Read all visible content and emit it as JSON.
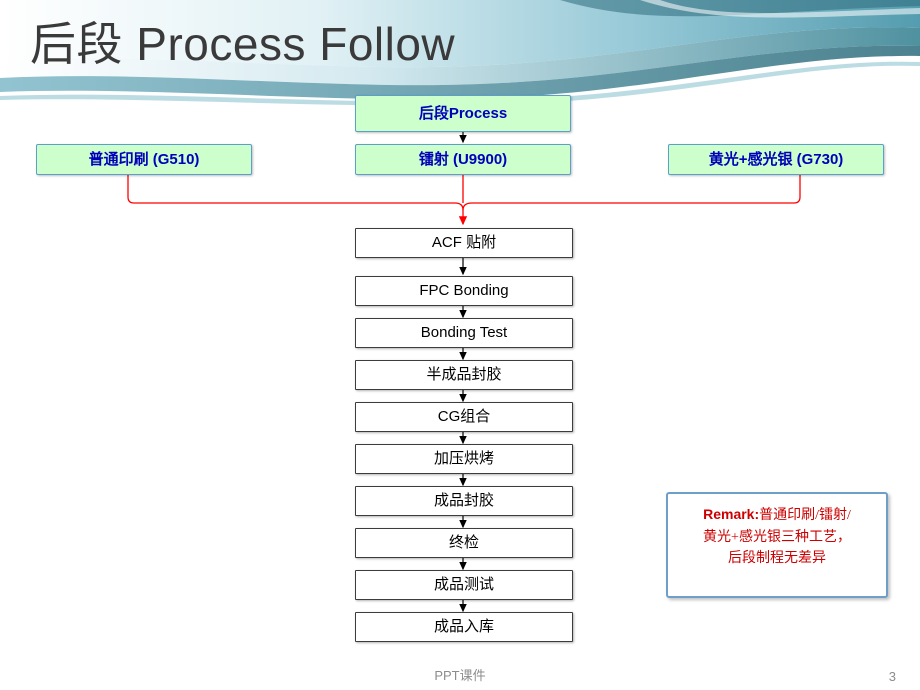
{
  "slide": {
    "title": "后段 Process  Follow",
    "footer": "PPT课件",
    "page_number": "3"
  },
  "flow": {
    "top_box": {
      "label": "后段Process"
    },
    "branches": [
      {
        "label": "普通印刷 (G510)"
      },
      {
        "label": "镭射 (U9900)"
      },
      {
        "label": "黄光+感光银 (G730)"
      }
    ],
    "steps": [
      {
        "label": "ACF 贴附"
      },
      {
        "label": "FPC Bonding"
      },
      {
        "label": "Bonding Test"
      },
      {
        "label": "半成品封胶"
      },
      {
        "label": "CG组合"
      },
      {
        "label": "加压烘烤"
      },
      {
        "label": "成品封胶"
      },
      {
        "label": "终检"
      },
      {
        "label": "成品测试"
      },
      {
        "label": "成品入库"
      }
    ]
  },
  "remark": {
    "label": "Remark:",
    "line1": "普通印刷/镭射/",
    "line2": "黄光+感光银三种工艺，",
    "line3": "后段制程无差异"
  },
  "colors": {
    "green_fill": "#ccffcc",
    "box_border": "#5aa0c8",
    "box_text": "#0000bb",
    "connector_red": "#ff0000",
    "connector_black": "#000000",
    "remark_text": "#cc0000",
    "header_teal": "#3f8f9e"
  }
}
